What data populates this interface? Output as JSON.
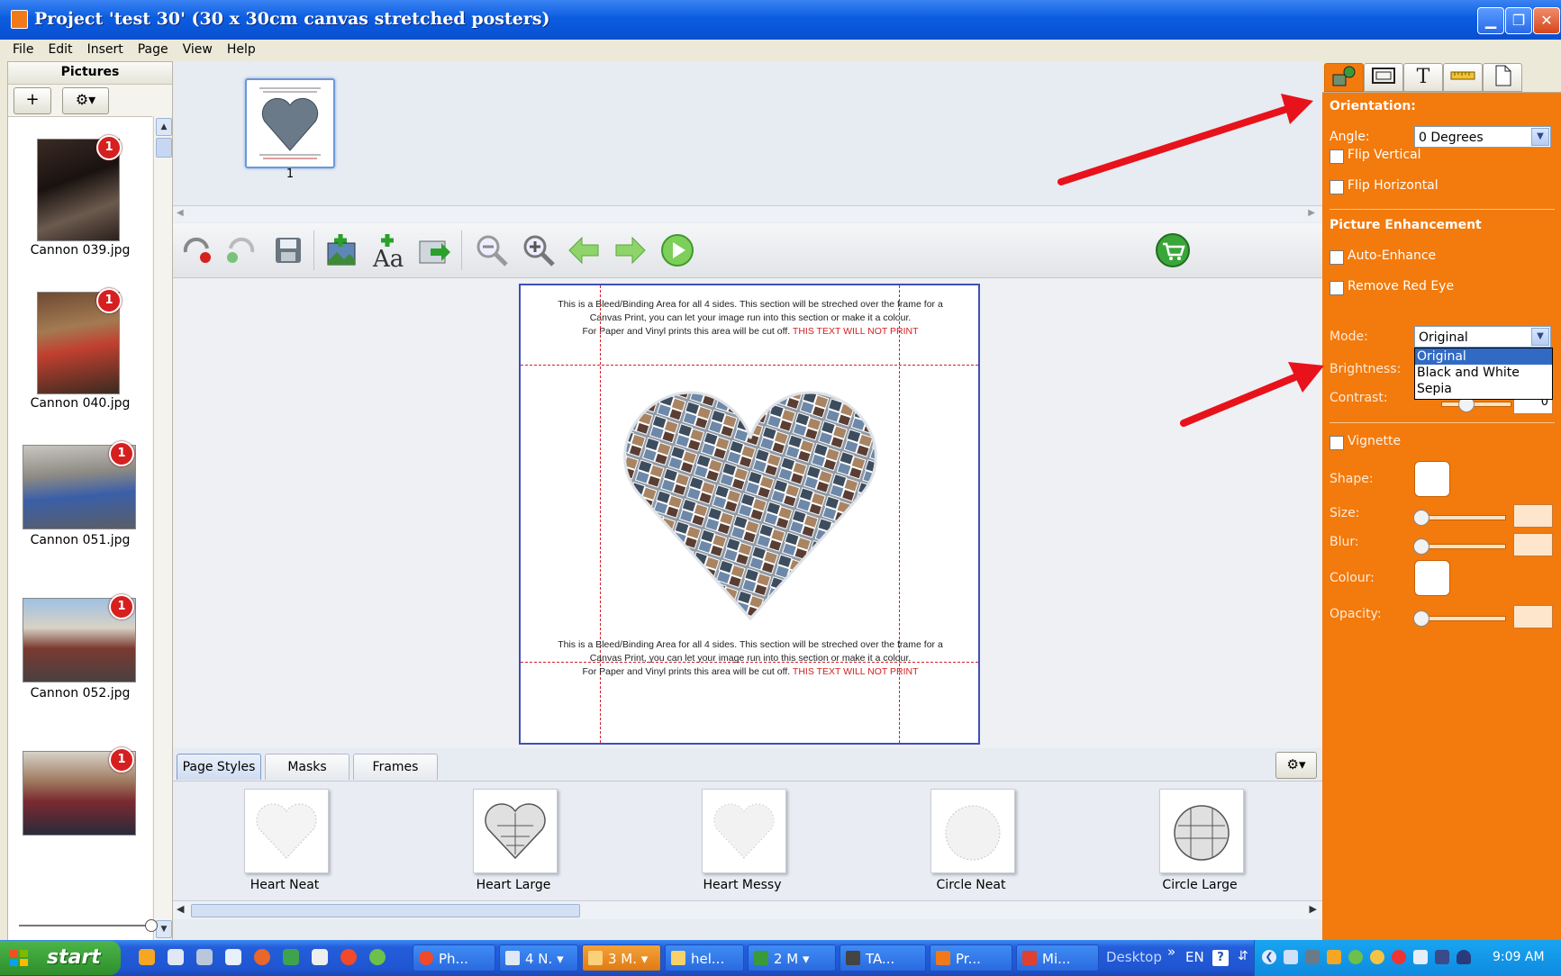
{
  "window": {
    "title": "Project 'test 30' (30 x 30cm canvas stretched posters)",
    "min_glyph": "▁",
    "max_glyph": "❐",
    "close_glyph": "✕"
  },
  "menu": [
    "File",
    "Edit",
    "Insert",
    "Page",
    "View",
    "Help"
  ],
  "pictures_panel": {
    "header": "Pictures",
    "add_glyph": "+",
    "gear_glyph": "⚙▾",
    "items": [
      {
        "name": "Cannon 039.jpg",
        "count": "1"
      },
      {
        "name": "Cannon 040.jpg",
        "count": "1"
      },
      {
        "name": "Cannon 051.jpg",
        "count": "1"
      },
      {
        "name": "Cannon 052.jpg",
        "count": "1"
      },
      {
        "name": "",
        "count": "1"
      }
    ]
  },
  "page_strip": {
    "pages": [
      {
        "number": "1"
      }
    ]
  },
  "bleed_text": {
    "line1": "This is a Bleed/Binding Area for all 4 sides. This section will be streched over the frame for a Canvas Print, you can let your image run into this section or make it a colour.",
    "line2": "For Paper and Vinyl prints this area will be cut off.",
    "warning": "THIS TEXT WILL NOT PRINT"
  },
  "bottom_tabs": [
    "Page Styles",
    "Masks",
    "Frames"
  ],
  "bottom_gear": "⚙▾",
  "page_styles": [
    "Heart Neat",
    "Heart Large",
    "Heart Messy",
    "Circle Neat",
    "Circle Large"
  ],
  "right_panel": {
    "tab_text_glyph": "T",
    "orientation_title": "Orientation:",
    "angle_label": "Angle:",
    "angle_value": "0 Degrees",
    "flip_vertical": "Flip Vertical",
    "flip_horizontal": "Flip Horizontal",
    "enhancement_title": "Picture Enhancement",
    "auto_enhance": "Auto-Enhance",
    "remove_red_eye": "Remove Red Eye",
    "mode_label": "Mode:",
    "mode_value": "Original",
    "mode_options": [
      "Original",
      "Black and White",
      "Sepia"
    ],
    "brightness_label": "Brightness:",
    "contrast_label": "Contrast:",
    "contrast_value": "0",
    "vignette": "Vignette",
    "shape_label": "Shape:",
    "size_label": "Size:",
    "blur_label": "Blur:",
    "colour_label": "Colour:",
    "opacity_label": "Opacity:"
  },
  "taskbar": {
    "start": "start",
    "tasks": [
      "Ph...",
      "4 N.",
      "3 M.",
      "hel...",
      "2 M",
      "TA...",
      "Pr...",
      "Mi..."
    ],
    "desktop": "Desktop",
    "chevrons": "»",
    "lang": "EN",
    "time": "9:09 AM"
  },
  "colors": {
    "panel_orange": "#f37a0c",
    "annotation_red": "#e8121b",
    "xp_blue": "#245edb"
  }
}
